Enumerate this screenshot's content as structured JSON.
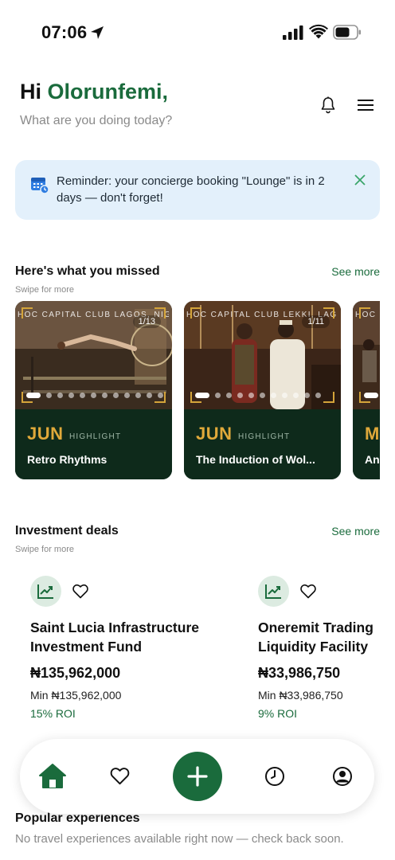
{
  "status_bar": {
    "time": "07:06",
    "icons": [
      "location-arrow-icon",
      "cellular-signal-icon",
      "wifi-icon",
      "battery-icon"
    ]
  },
  "header": {
    "greeting_prefix": "Hi",
    "greeting_name": "Olorunfemi,",
    "subtitle": "What are you doing today?",
    "icons": [
      "bell-icon",
      "hamburger-menu-icon"
    ]
  },
  "reminder": {
    "text": "Reminder: your concierge booking \"Lounge\" is in 2 days — don't forget!",
    "icon": "calendar-icon",
    "close_icon": "close-icon"
  },
  "highlights": {
    "title": "Here's what you missed",
    "subtitle": "Swipe for more",
    "see_more": "See more",
    "cards": [
      {
        "venue": "HOC CAPITAL CLUB LAGOS, NIG...",
        "counter": "1/13",
        "month": "JUN",
        "tag": "HIGHLIGHT",
        "title": "Retro Rhythms",
        "dots": 13,
        "active_dot": 1
      },
      {
        "venue": "HOC CAPITAL CLUB LEKKI, LAG...",
        "counter": "1/11",
        "month": "JUN",
        "tag": "HIGHLIGHT",
        "title": "The Induction of Wol...",
        "dots": 11,
        "active_dot": 1
      },
      {
        "venue": "HOC",
        "counter": "",
        "month": "M",
        "tag": "",
        "title": "An",
        "dots": 1,
        "active_dot": 1
      }
    ]
  },
  "investments": {
    "title": "Investment deals",
    "subtitle": "Swipe for more",
    "see_more": "See more",
    "deals": [
      {
        "title": "Saint Lucia Infrastructure Investment Fund",
        "price": "₦135,962,000",
        "min": "Min ₦135,962,000",
        "roi": "15% ROI"
      },
      {
        "title": "Oneremit Trading Liquidity Facility",
        "price": "₦33,986,750",
        "min": "Min ₦33,986,750",
        "roi": "9% ROI"
      }
    ]
  },
  "bottom_nav": {
    "items": [
      "home-icon",
      "heart-icon",
      "plus-icon",
      "history-clock-icon",
      "profile-icon"
    ],
    "active": "home-icon"
  },
  "popular": {
    "title": "Popular experiences",
    "empty_text": "No travel experiences available right now — check back soon."
  },
  "colors": {
    "brand_green": "#1a6b3c",
    "card_dark": "#0e2a1b",
    "gold": "#e0a93a",
    "reminder_bg": "#e3f0fb"
  }
}
